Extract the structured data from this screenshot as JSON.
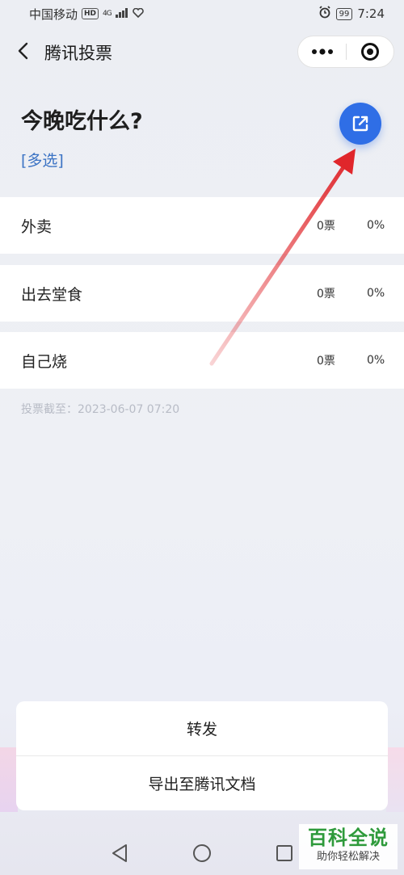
{
  "status_bar": {
    "carrier": "中国移动",
    "hd": "HD",
    "network": "4G",
    "battery": "99",
    "time": "7:24"
  },
  "nav": {
    "back_icon": "chevron-left-icon",
    "title": "腾讯投票",
    "more_icon": "more-dots-icon",
    "close_icon": "target-close-icon"
  },
  "vote": {
    "title": "今晚吃什么?",
    "type_tag": "[多选]",
    "share_icon": "external-share-icon",
    "accent_color": "#2f6ee6"
  },
  "options": [
    {
      "label": "外卖",
      "votes": "0票",
      "percent": "0%"
    },
    {
      "label": "出去堂食",
      "votes": "0票",
      "percent": "0%"
    },
    {
      "label": "自己烧",
      "votes": "0票",
      "percent": "0%"
    }
  ],
  "deadline": "投票截至：2023-06-07 07:20",
  "annotation": {
    "arrow_color": "#e0262b"
  },
  "action_sheet": {
    "items": [
      "转发",
      "导出至腾讯文档"
    ]
  },
  "system_nav": {
    "back": "triangle-back-icon",
    "home": "circle-home-icon",
    "recent": "square-recent-icon"
  },
  "watermark": {
    "title": "百科全说",
    "subtitle": "助你轻松解决"
  }
}
